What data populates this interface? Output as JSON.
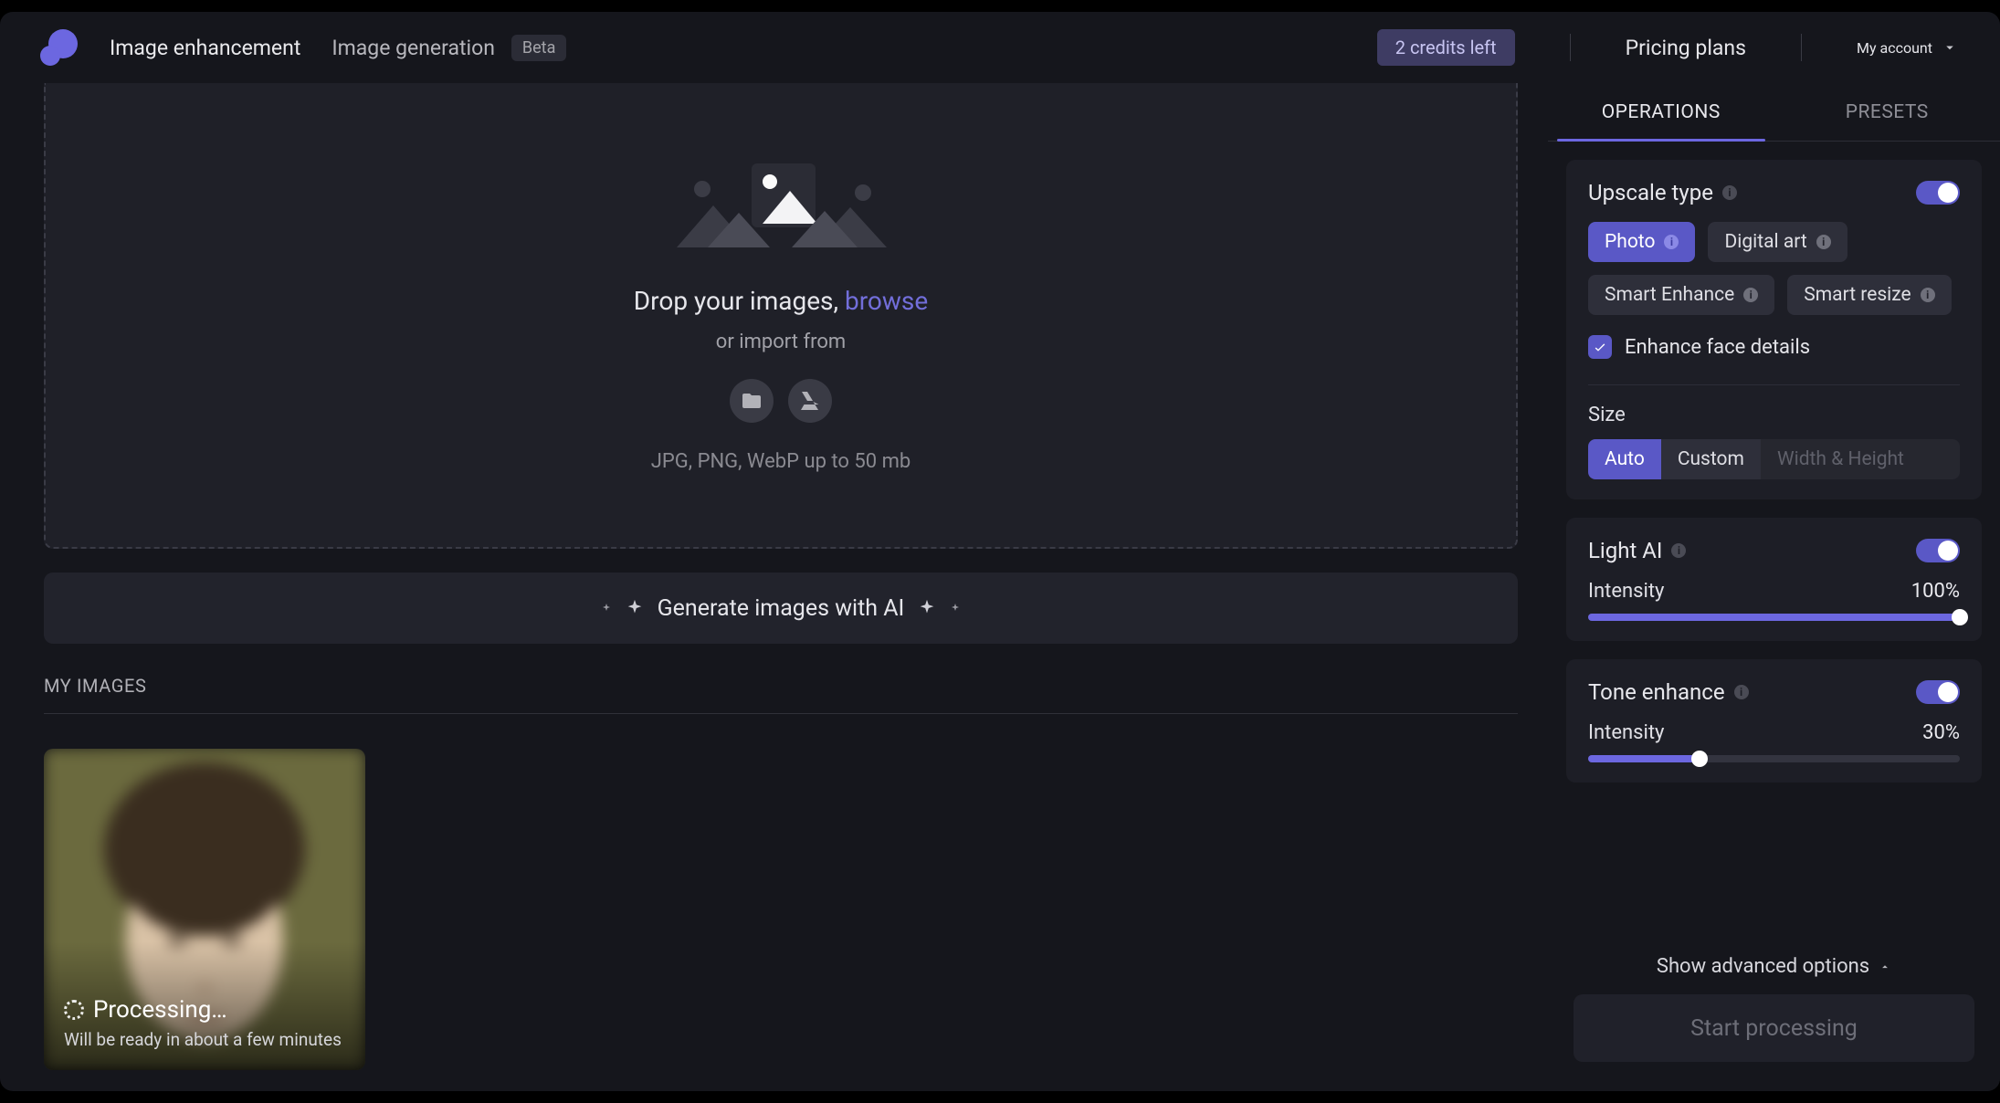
{
  "header": {
    "nav_enhance": "Image enhancement",
    "nav_generate": "Image generation",
    "beta": "Beta",
    "credits": "2 credits left",
    "pricing": "Pricing plans",
    "account": "My account"
  },
  "dropzone": {
    "title_prefix": "Drop your images, ",
    "browse": "browse",
    "subtitle": "or import from",
    "formats": "JPG, PNG, WebP up to 50 mb"
  },
  "generate_bar": "Generate images with AI",
  "my_images": {
    "title": "MY IMAGES",
    "items": [
      {
        "status": "Processing…",
        "sub": "Will be ready in about a few minutes"
      }
    ]
  },
  "sidebar": {
    "tabs": {
      "operations": "OPERATIONS",
      "presets": "PRESETS",
      "active": "operations"
    },
    "upscale": {
      "title": "Upscale type",
      "chips": [
        "Photo",
        "Digital art",
        "Smart Enhance",
        "Smart resize"
      ],
      "active_chip": "Photo",
      "enhance_face": "Enhance face details",
      "size_title": "Size",
      "size_auto": "Auto",
      "size_custom": "Custom",
      "size_placeholder": "Width & Height"
    },
    "light": {
      "title": "Light AI",
      "intensity_label": "Intensity",
      "intensity_value": "100%",
      "intensity_pct": 100
    },
    "tone": {
      "title": "Tone enhance",
      "intensity_label": "Intensity",
      "intensity_value": "30%",
      "intensity_pct": 30
    },
    "advanced": "Show advanced options",
    "start": "Start processing"
  }
}
